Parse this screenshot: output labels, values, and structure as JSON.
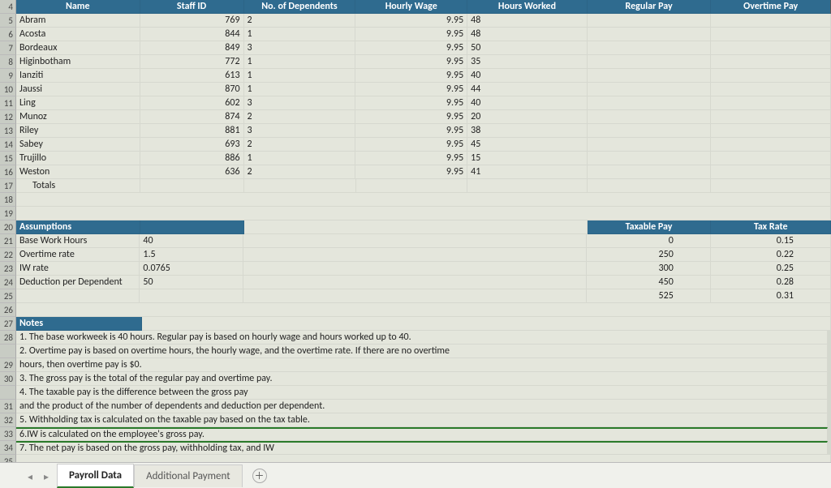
{
  "headers": {
    "name": "Name",
    "staff": "Staff ID",
    "dependents": "No. of Dependents",
    "wage": "Hourly Wage",
    "hours": "Hours Worked",
    "reg": "Regular Pay",
    "ot": "Overtime Pay"
  },
  "employees": [
    {
      "row": "5",
      "name": "Abram",
      "staff": "769",
      "dep": "2",
      "wage": "9.95",
      "hours": "48"
    },
    {
      "row": "6",
      "name": "Acosta",
      "staff": "844",
      "dep": "1",
      "wage": "9.95",
      "hours": "48"
    },
    {
      "row": "7",
      "name": "Bordeaux",
      "staff": "849",
      "dep": "3",
      "wage": "9.95",
      "hours": "50"
    },
    {
      "row": "8",
      "name": "Higinbotham",
      "staff": "772",
      "dep": "1",
      "wage": "9.95",
      "hours": "35"
    },
    {
      "row": "9",
      "name": "Ianziti",
      "staff": "613",
      "dep": "1",
      "wage": "9.95",
      "hours": "40"
    },
    {
      "row": "10",
      "name": "Jaussi",
      "staff": "870",
      "dep": "1",
      "wage": "9.95",
      "hours": "44"
    },
    {
      "row": "11",
      "name": "Ling",
      "staff": "602",
      "dep": "3",
      "wage": "9.95",
      "hours": "40"
    },
    {
      "row": "12",
      "name": "Munoz",
      "staff": "874",
      "dep": "2",
      "wage": "9.95",
      "hours": "20"
    },
    {
      "row": "13",
      "name": "Riley",
      "staff": "881",
      "dep": "3",
      "wage": "9.95",
      "hours": "38"
    },
    {
      "row": "14",
      "name": "Sabey",
      "staff": "693",
      "dep": "2",
      "wage": "9.95",
      "hours": "45"
    },
    {
      "row": "15",
      "name": "Trujillo",
      "staff": "886",
      "dep": "1",
      "wage": "9.95",
      "hours": "15"
    },
    {
      "row": "16",
      "name": "Weston",
      "staff": "636",
      "dep": "2",
      "wage": "9.95",
      "hours": "41"
    }
  ],
  "totals_label": "Totals",
  "totals_row": "17",
  "assumptions_header": "Assumptions",
  "assumptions": [
    {
      "row": "21",
      "label": "Base Work Hours",
      "value": "40"
    },
    {
      "row": "22",
      "label": "Overtime rate",
      "value": "1.5"
    },
    {
      "row": "23",
      "label": "IW rate",
      "value": "0.0765"
    },
    {
      "row": "24",
      "label": "Deduction per Dependent",
      "value": "50"
    }
  ],
  "tax_headers": {
    "pay": "Taxable Pay",
    "rate": "Tax Rate"
  },
  "tax_table": [
    {
      "pay": "0",
      "rate": "0.15"
    },
    {
      "pay": "250",
      "rate": "0.22"
    },
    {
      "pay": "300",
      "rate": "0.25"
    },
    {
      "pay": "450",
      "rate": "0.28"
    },
    {
      "pay": "525",
      "rate": "0.31"
    }
  ],
  "notes_header": "Notes",
  "notes": [
    {
      "row": "28",
      "text": "1. The base workweek is 40 hours. Regular pay is based on hourly wage and hours worked up to 40."
    },
    {
      "row": "",
      "text": "2. Overtime pay is based on overtime hours, the hourly wage, and the overtime rate. If there are no overtime"
    },
    {
      "row": "29",
      "text": "hours, then overtime pay is $0."
    },
    {
      "row": "30",
      "text": "3. The gross pay is the total of the regular pay and overtime pay."
    },
    {
      "row": "",
      "text": "4. The taxable pay is the difference between the gross pay"
    },
    {
      "row": "31",
      "text": "    and the product of the number of dependents and deduction per dependent."
    },
    {
      "row": "32",
      "text": "5. Withholding tax is calculated on the taxable pay based on the tax table."
    },
    {
      "row": "33",
      "text": "6.IW is calculated on the employee's gross pay."
    },
    {
      "row": "34",
      "text": "7. The net pay is based on the gross pay, withholding tax, and IW"
    }
  ],
  "tabs": {
    "active": "Payroll Data",
    "inactive": "Additional Payment"
  }
}
